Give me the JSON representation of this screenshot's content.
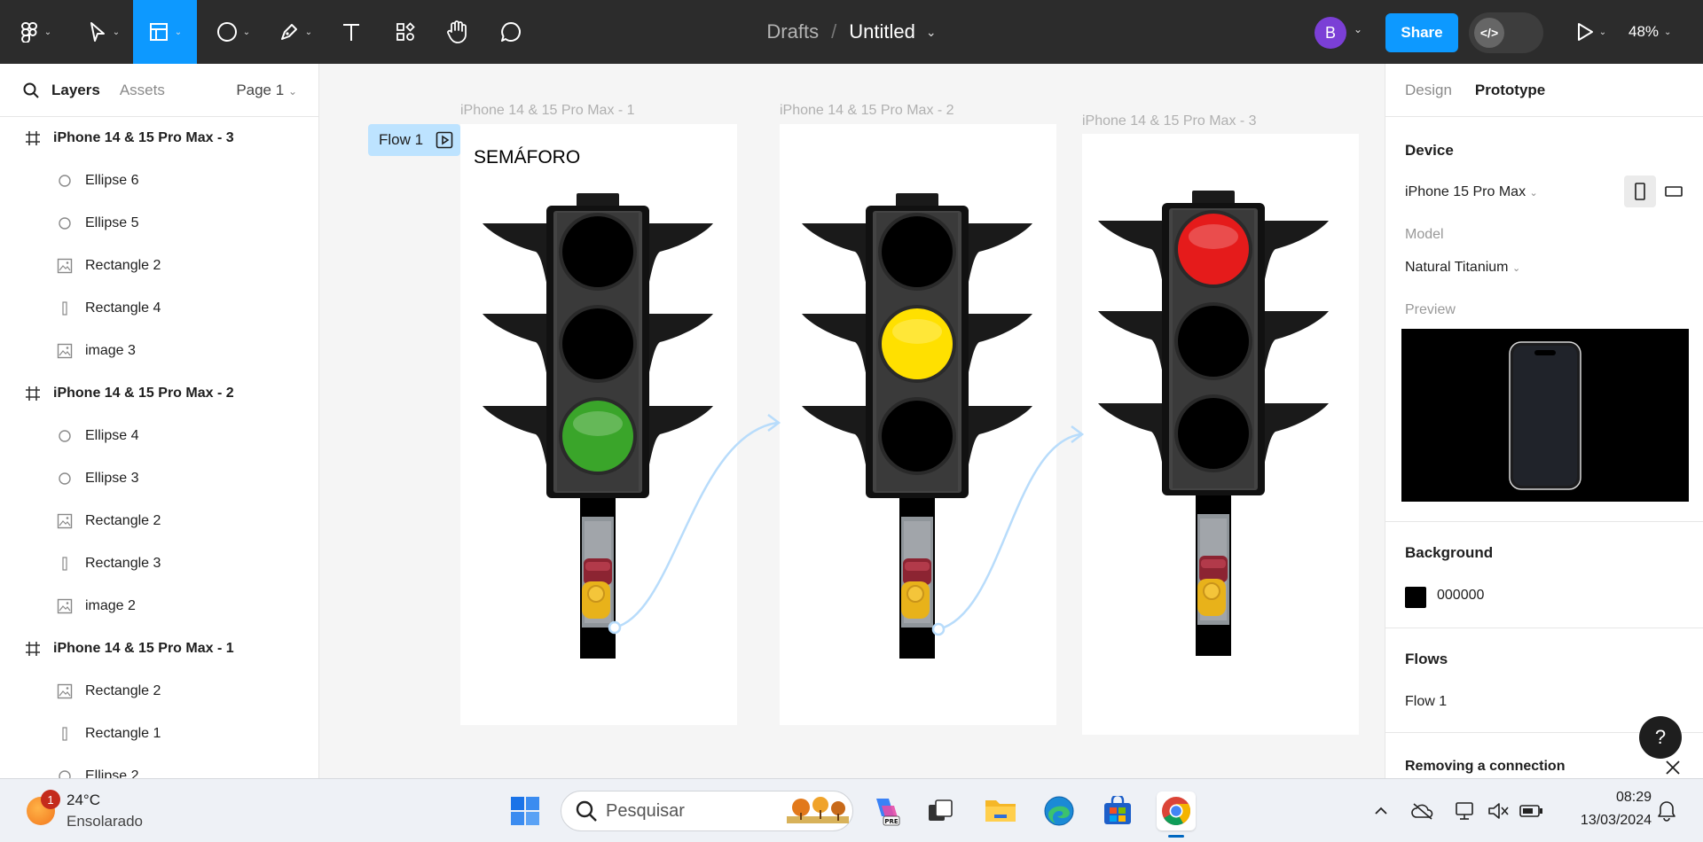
{
  "toolbar": {
    "breadcrumb_root": "Drafts",
    "separator": "/",
    "title": "Untitled",
    "avatar_initial": "B",
    "share_label": "Share",
    "dev_mode_icon": "</>",
    "zoom": "48%",
    "accent": "#0d99ff"
  },
  "left_panel": {
    "tabs": {
      "layers": "Layers",
      "assets": "Assets"
    },
    "page": "Page 1",
    "layers": [
      {
        "name": "iPhone 14 & 15 Pro Max - 3",
        "kind": "frame"
      },
      {
        "name": "Ellipse 6",
        "kind": "ellipse"
      },
      {
        "name": "Ellipse 5",
        "kind": "ellipse"
      },
      {
        "name": "Rectangle 2",
        "kind": "image"
      },
      {
        "name": "Rectangle 4",
        "kind": "rect"
      },
      {
        "name": "image 3",
        "kind": "image"
      },
      {
        "name": "iPhone 14 & 15 Pro Max - 2",
        "kind": "frame"
      },
      {
        "name": "Ellipse 4",
        "kind": "ellipse"
      },
      {
        "name": "Ellipse 3",
        "kind": "ellipse"
      },
      {
        "name": "Rectangle 2",
        "kind": "image"
      },
      {
        "name": "Rectangle 3",
        "kind": "rect"
      },
      {
        "name": "image 2",
        "kind": "image"
      },
      {
        "name": "iPhone 14 & 15 Pro Max - 1",
        "kind": "frame"
      },
      {
        "name": "Rectangle 2",
        "kind": "image"
      },
      {
        "name": "Rectangle 1",
        "kind": "rect"
      },
      {
        "name": "Ellipse 2",
        "kind": "ellipse"
      }
    ]
  },
  "canvas": {
    "flow_badge": "Flow 1",
    "frames": [
      {
        "label": "iPhone 14 & 15 Pro Max - 1",
        "lit": "green"
      },
      {
        "label": "iPhone 14 & 15 Pro Max - 2",
        "lit": "yellow"
      },
      {
        "label": "iPhone 14 & 15 Pro Max - 3",
        "lit": "red"
      }
    ],
    "frame1_text": "SEMÁFORO",
    "light_colors": {
      "red": "#e51b1b",
      "yellow": "#ffe000",
      "green": "#3aa52a",
      "off": "#000000"
    }
  },
  "right_panel": {
    "tabs": {
      "design": "Design",
      "prototype": "Prototype"
    },
    "device_heading": "Device",
    "device_value": "iPhone 15 Pro Max",
    "model_label": "Model",
    "model_value": "Natural Titanium",
    "preview_label": "Preview",
    "background_heading": "Background",
    "background_value": "000000",
    "flows_heading": "Flows",
    "flow_item": "Flow 1",
    "removing_heading": "Removing a connection",
    "help": "?"
  },
  "taskbar": {
    "notification_count": "1",
    "temperature": "24°C",
    "weather": "Ensolarado",
    "search_placeholder": "Pesquisar",
    "time": "08:29",
    "date": "13/03/2024"
  }
}
